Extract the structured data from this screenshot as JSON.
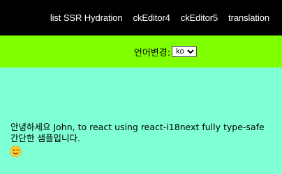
{
  "nav": {
    "links": [
      {
        "label": "list SSR Hydration"
      },
      {
        "label": "ckEditor4"
      },
      {
        "label": "ckEditor5"
      },
      {
        "label": "translation"
      }
    ]
  },
  "language": {
    "label": "언어변경:",
    "selected": "ko"
  },
  "content": {
    "line1": "안녕하세요 John, to react using react-i18next fully type-safe",
    "line2": "간단한 샘플입니다.",
    "emoji": "winking-face"
  },
  "colors": {
    "nav_bg": "#000000",
    "lang_bg": "#7fff00",
    "main_bg": "#7fffd4"
  }
}
